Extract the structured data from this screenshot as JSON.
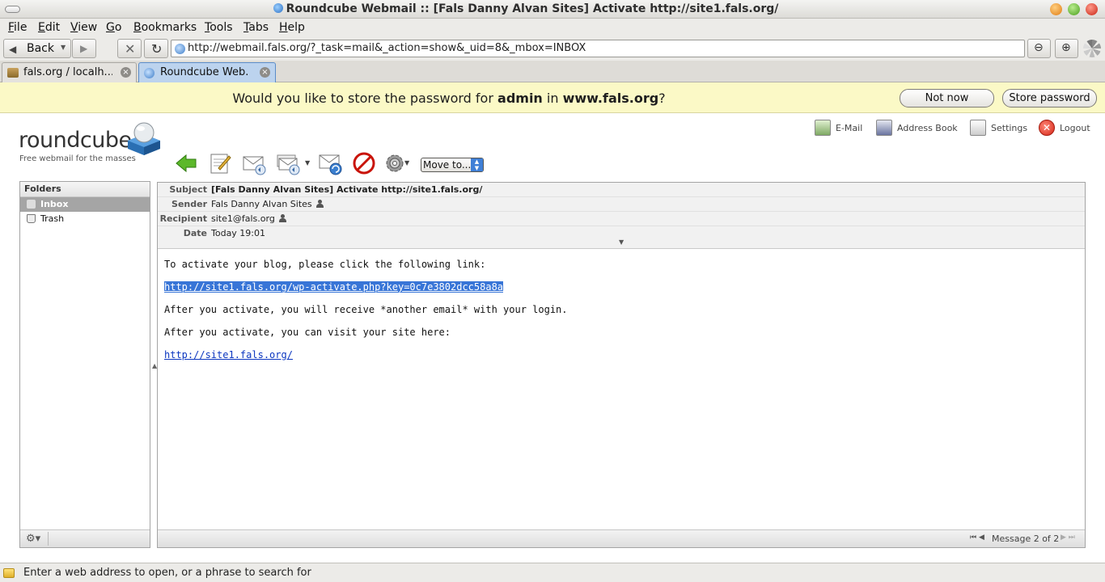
{
  "window": {
    "title": "Roundcube Webmail :: [Fals Danny Alvan Sites] Activate http://site1.fals.org/"
  },
  "menu": [
    "File",
    "Edit",
    "View",
    "Go",
    "Bookmarks",
    "Tools",
    "Tabs",
    "Help"
  ],
  "nav": {
    "back_label": "Back",
    "url": "http://webmail.fals.org/?_task=mail&_action=show&_uid=8&_mbox=INBOX"
  },
  "tabs": [
    {
      "label": "fals.org / localh..."
    },
    {
      "label": "Roundcube Web..."
    }
  ],
  "notification": {
    "prefix": "Would you like to store the password for ",
    "user": "admin",
    "middle": " in ",
    "site": "www.fals.org",
    "suffix": "?",
    "not_now": "Not now",
    "store": "Store password"
  },
  "app": {
    "logo_word": "roundcube",
    "logo_tagline": "Free webmail for the masses",
    "topnav": {
      "email": "E-Mail",
      "address_book": "Address Book",
      "settings": "Settings",
      "logout": "Logout"
    },
    "move_to": "Move to...",
    "folders_title": "Folders",
    "folders": [
      {
        "label": "Inbox",
        "selected": true
      },
      {
        "label": "Trash",
        "selected": false
      }
    ]
  },
  "message": {
    "headers": {
      "subject_label": "Subject",
      "subject": "[Fals Danny Alvan Sites] Activate http://site1.fals.org/",
      "sender_label": "Sender",
      "sender": "Fals Danny Alvan Sites",
      "recipient_label": "Recipient",
      "recipient": "site1@fals.org",
      "date_label": "Date",
      "date": "Today 19:01"
    },
    "body": {
      "line1": "To activate your blog, please click the following link:",
      "activate_link": "http://site1.fals.org/wp-activate.php?key=0c7e3802dcc58a8a",
      "line2": "After you activate, you will receive *another email* with your login.",
      "line3": "After you activate, you can visit your site here:",
      "site_link": "http://site1.fals.org/"
    },
    "counter": "Message 2 of 2"
  },
  "status_bar": "Enter a web address to open, or a phrase to search for"
}
